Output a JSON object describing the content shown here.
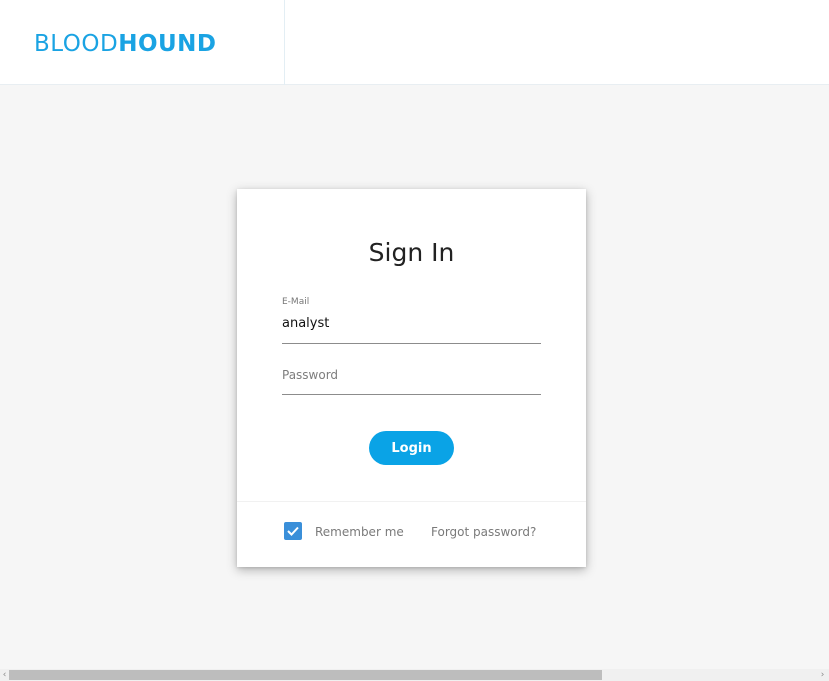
{
  "header": {
    "logo_light": "BLOOD",
    "logo_bold": "HOUND",
    "logo_color": "#1aa3e3"
  },
  "login_card": {
    "title": "Sign In",
    "email": {
      "label": "E-Mail",
      "value": "analyst"
    },
    "password": {
      "placeholder": "Password",
      "value": ""
    },
    "login_button": "Login",
    "remember_me": {
      "label": "Remember me",
      "checked": true
    },
    "forgot_password": "Forgot password?",
    "accent_color": "#0aa3e6"
  },
  "scrollbar": {
    "left_arrow": "‹",
    "right_arrow": "›"
  }
}
